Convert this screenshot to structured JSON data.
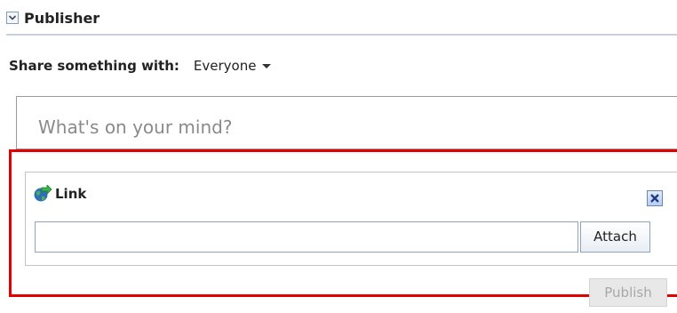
{
  "publisher": {
    "title": "Publisher",
    "collapse_icon": "chevron-down-icon"
  },
  "share": {
    "label": "Share something with:",
    "target": "Everyone",
    "target_icon": "caret-down-icon"
  },
  "status": {
    "placeholder": "What's on your mind?"
  },
  "link_panel": {
    "title": "Link",
    "icon": "globe-link-icon",
    "close_icon": "close-icon",
    "url_value": "",
    "attach_label": "Attach"
  },
  "actions": {
    "publish_label": "Publish",
    "publish_enabled": false
  },
  "colors": {
    "highlight": "#e30000",
    "header_rule": "#c6d0dc",
    "placeholder_text": "#8a8a8a",
    "disabled_text": "#a8a8a8"
  }
}
